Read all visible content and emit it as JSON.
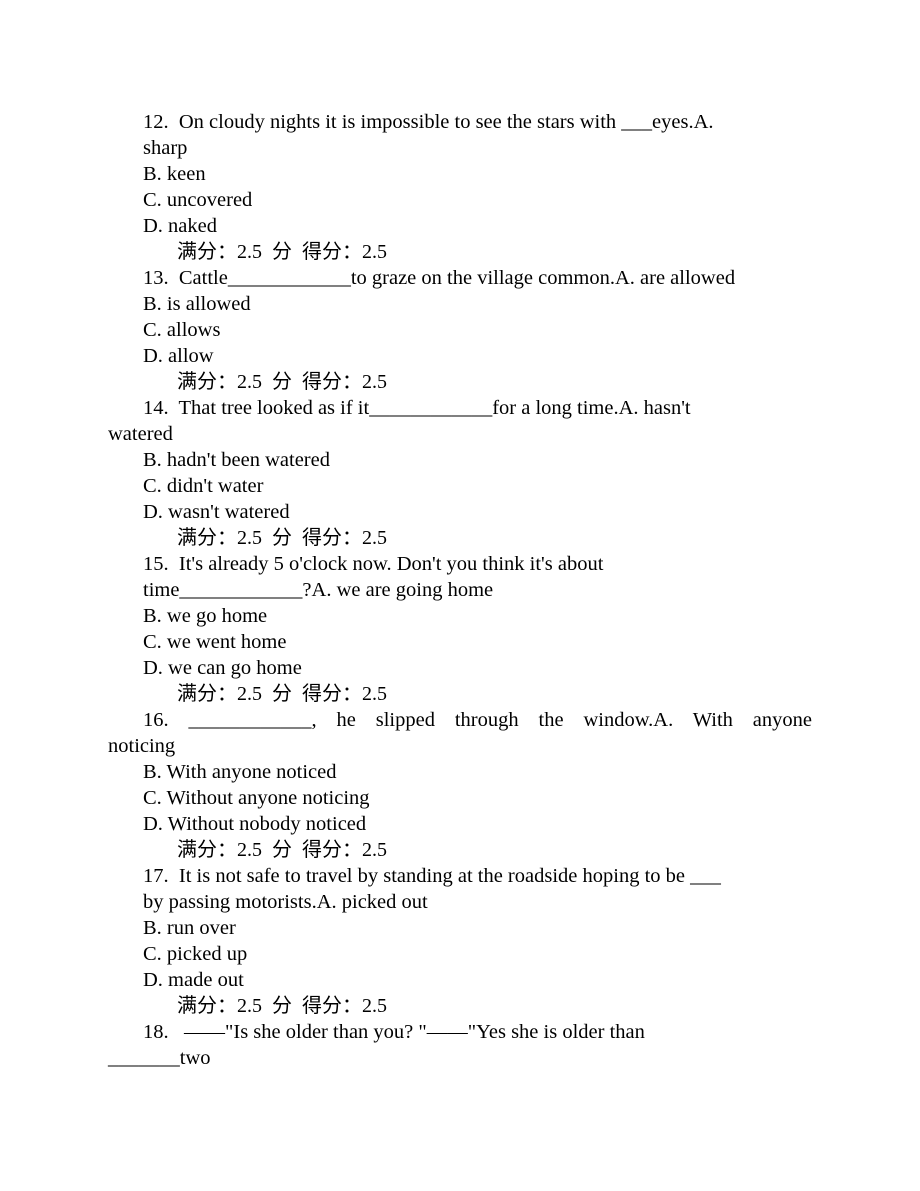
{
  "document": {
    "questions": [
      {
        "number": "12.",
        "lines": [
          "12.  On cloudy nights it is impossible to see the stars with ___eyes.A.",
          "sharp"
        ],
        "options": [
          "B. keen",
          "C. uncovered",
          "D. naked"
        ],
        "score": "满分：2.5  分  得分：2.5"
      },
      {
        "number": "13.",
        "lines": [
          "13.  Cattle____________to graze on the village common.A. are allowed"
        ],
        "options": [
          "B. is allowed",
          "C. allows",
          "D. allow"
        ],
        "score": "满分：2.5  分  得分：2.5"
      },
      {
        "number": "14.",
        "lines": [
          "14.  That tree looked as if it____________for a long time.A. hasn't",
          "watered"
        ],
        "options": [
          "B. hadn't been watered",
          "C. didn't water",
          "D. wasn't watered"
        ],
        "score": "满分：2.5  分  得分：2.5"
      },
      {
        "number": "15.",
        "lines": [
          "15.  It's already 5 o'clock now. Don't you think it's about",
          "time____________?A. we are going home"
        ],
        "options": [
          "B. we go home",
          "C. we went home",
          "D. we can go home"
        ],
        "score": "满分：2.5  分  得分：2.5"
      },
      {
        "number": "16.",
        "lines": [
          "16.  ____________, he slipped through the window.A.  With  anyone",
          "noticing"
        ],
        "options": [
          "B. With anyone noticed",
          "C. Without anyone noticing",
          "D. Without nobody noticed"
        ],
        "score": "满分：2.5  分  得分：2.5"
      },
      {
        "number": "17.",
        "lines": [
          "17.  It is not safe to travel by standing at the roadside hoping to be ___",
          "by passing motorists.A. picked out"
        ],
        "options": [
          "B. run over",
          "C. picked up",
          "D. made out"
        ],
        "score": "满分：2.5  分  得分：2.5"
      },
      {
        "number": "18.",
        "lines": [
          "18.   ——\"Is she older than you? \"——\"Yes she is older than",
          "_______two"
        ],
        "options": [],
        "score": ""
      }
    ]
  }
}
